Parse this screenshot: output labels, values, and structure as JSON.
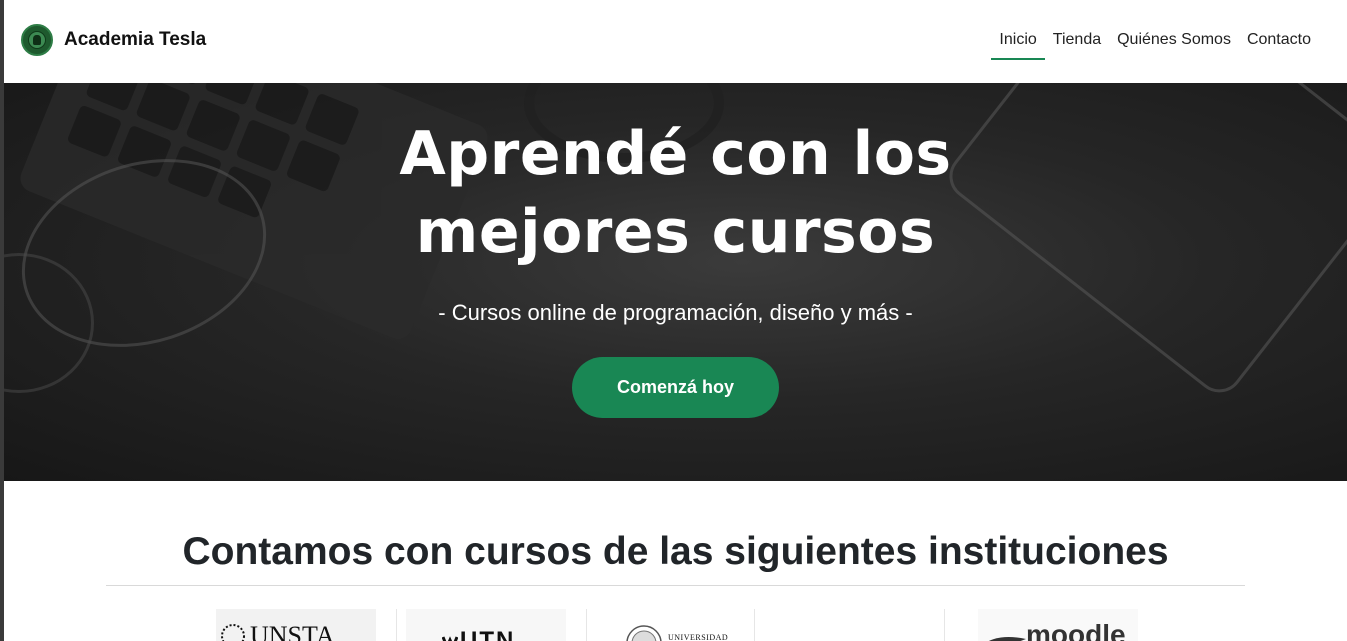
{
  "navbar": {
    "brand": "Academia Tesla",
    "links": [
      {
        "label": "Inicio",
        "active": true
      },
      {
        "label": "Tienda",
        "active": false
      },
      {
        "label": "Quiénes Somos",
        "active": false
      },
      {
        "label": "Contacto",
        "active": false
      }
    ]
  },
  "hero": {
    "title_line1": "Aprendé con los",
    "title_line2": "mejores cursos",
    "subtitle": "- Cursos online de programación, diseño y más -",
    "cta": "Comenzá hoy"
  },
  "institutions": {
    "title": "Contamos con cursos de las siguientes instituciones",
    "logos": [
      {
        "name": "UNSTA"
      },
      {
        "name": "UTN"
      },
      {
        "name": "UNIVERSIDAD"
      },
      {
        "name": ""
      },
      {
        "name": "moodle"
      }
    ]
  },
  "colors": {
    "accent": "#198754",
    "hero_background": "#1f1f1f"
  }
}
